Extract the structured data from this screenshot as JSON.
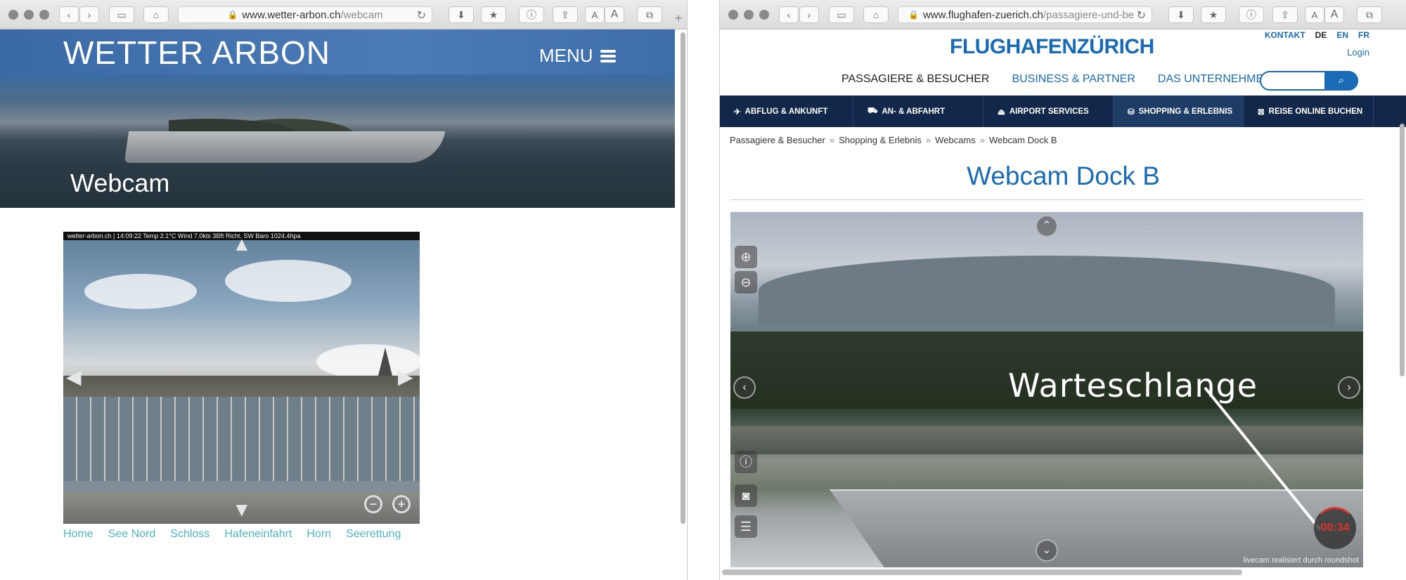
{
  "left": {
    "url": {
      "domain": "www.wetter-arbon.ch",
      "path": "/webcam"
    },
    "site_title": "WETTER ARBON",
    "menu_label": "MENU",
    "page_heading": "Webcam",
    "cam_overlay": "wetter-arbon.ch | 14:09:22 Temp 2.1°C Wind 7.0kts 3Bft Richt. SW Baro 1024.4hpa",
    "links": [
      "Home",
      "See Nord",
      "Schloss",
      "Hafeneinfahrt",
      "Horn",
      "Seerettung"
    ]
  },
  "right": {
    "url": {
      "domain": "www.flughafen-zuerich.ch",
      "path": "/passagiere-und-be"
    },
    "logo": "FLUGHAFENZÜRICH",
    "top_links": [
      "KONTAKT",
      "DE",
      "EN",
      "FR"
    ],
    "login": "Login",
    "main_nav": [
      "PASSAGIERE & BESUCHER",
      "BUSINESS & PARTNER",
      "DAS UNTERNEHMEN"
    ],
    "sub_nav": [
      "ABFLUG & ANKUNFT",
      "AN- & ABFAHRT",
      "AIRPORT SERVICES",
      "SHOPPING & ERLEBNIS",
      "REISE ONLINE BUCHEN"
    ],
    "breadcrumb": [
      "Passagiere & Besucher",
      "Shopping & Erlebnis",
      "Webcams",
      "Webcam Dock B"
    ],
    "breadcrumb_sep": "»",
    "heading": "Webcam Dock B",
    "cam_annotation": "Warteschlange",
    "timer": "00:34",
    "credit": "livecam realisiert durch roundshot"
  },
  "colors": {
    "fz_blue": "#1a6bb5",
    "fz_navy": "#12284a",
    "wa_link": "#4fb7c7",
    "timer_red": "#e0322b"
  }
}
